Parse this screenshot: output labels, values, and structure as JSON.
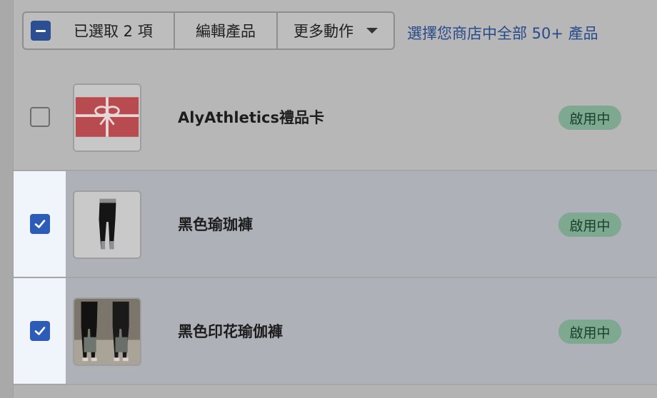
{
  "bulk_actions": {
    "selected_label": "已選取 2 項",
    "edit_label": "編輯產品",
    "more_label": "更多動作",
    "select_all_link": "選擇您商店中全部 50+ 產品"
  },
  "products": [
    {
      "name": "AlyAthletics禮品卡",
      "status": "啟用中",
      "checked": false,
      "thumb_icon": "gift-card-image"
    },
    {
      "name": "黑色瑜珈褲",
      "status": "啟用中",
      "checked": true,
      "thumb_icon": "leggings-image"
    },
    {
      "name": "黑色印花瑜伽褲",
      "status": "啟用中",
      "checked": true,
      "thumb_icon": "printed-leggings-photo"
    }
  ],
  "colors": {
    "accent": "#2c5bb8",
    "link": "#274a8a",
    "badge_bg": "#7ea88f",
    "badge_text": "#173f2a"
  }
}
